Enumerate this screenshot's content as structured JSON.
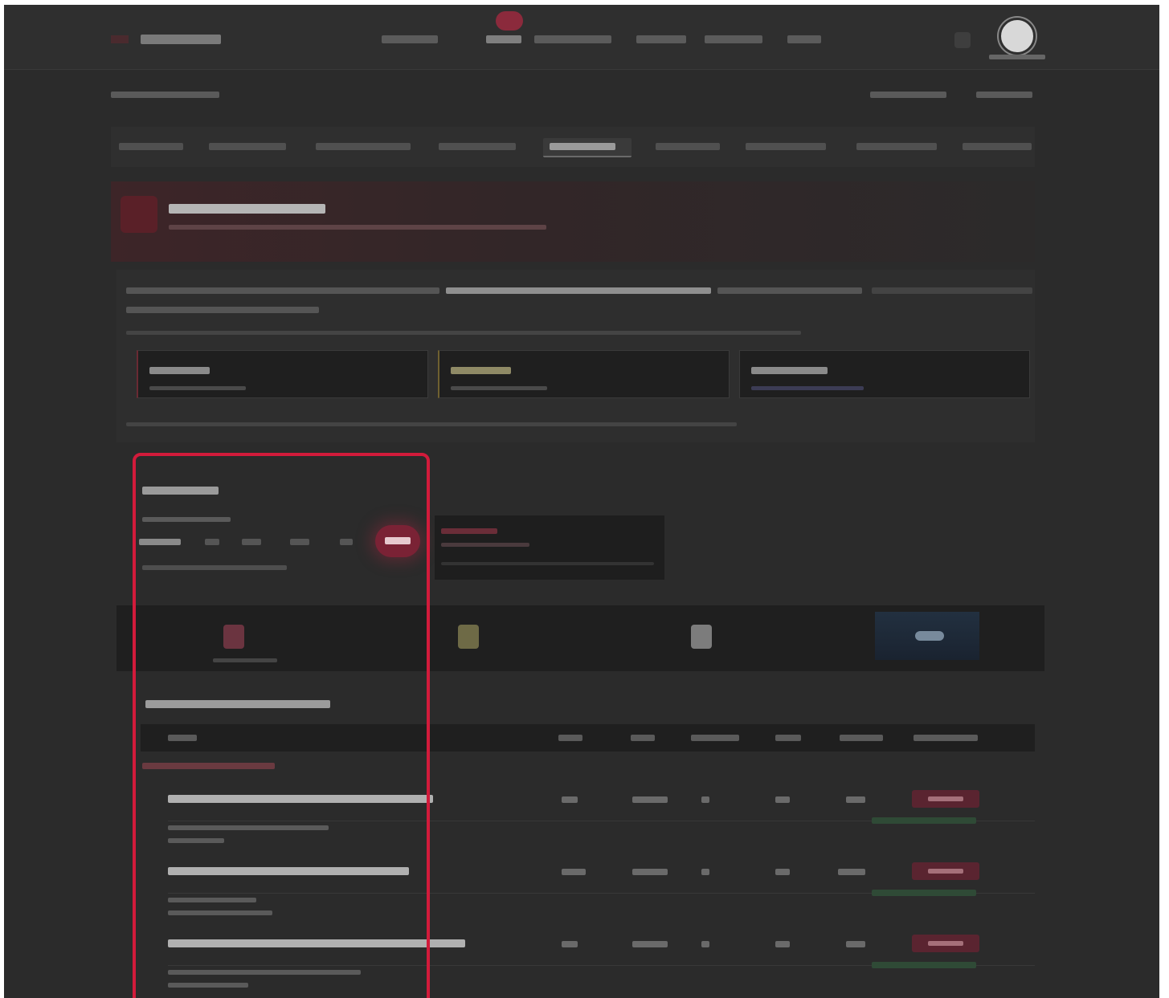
{
  "colors": {
    "page_bg": "#2b2b2b",
    "accent": "#8b2a3c",
    "highlight": "#d21b3b"
  },
  "topnav": {
    "logo_icon": "logo-icon",
    "items": [
      "",
      "",
      "",
      "",
      "",
      ""
    ],
    "search_icon": "search-icon",
    "avatar_icon": "avatar-icon"
  },
  "table": {
    "action_icon": "action-icon"
  },
  "annotation": {
    "shape": "rounded-rectangle",
    "color": "#d21b3b"
  }
}
